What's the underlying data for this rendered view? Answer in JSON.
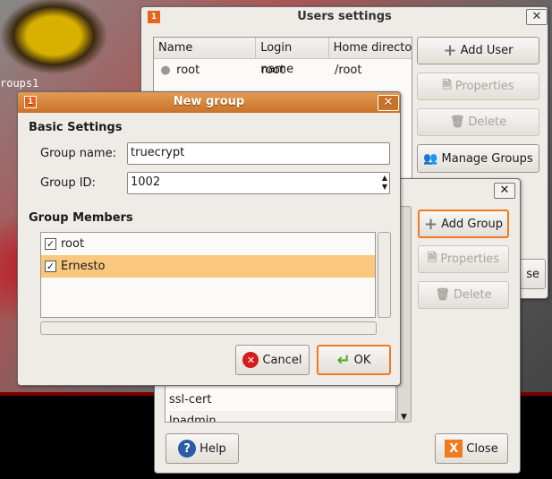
{
  "desktop": {
    "label": "roups1"
  },
  "users_window": {
    "title": "Users settings",
    "columns": [
      "Name",
      "Login name",
      "Home directo"
    ],
    "rows": [
      {
        "name": "root",
        "login": "root",
        "home": "/root"
      }
    ],
    "buttons": {
      "add_user": "Add User",
      "properties": "Properties",
      "delete": "Delete",
      "manage_groups": "Manage Groups",
      "close_partial": "se"
    }
  },
  "groups_window": {
    "rows": [
      "ssl-cert",
      "lpadmin"
    ],
    "buttons": {
      "add_group": "Add Group",
      "properties": "Properties",
      "delete": "Delete",
      "help": "Help",
      "close": "Close"
    }
  },
  "new_group": {
    "title": "New group",
    "basic_settings": "Basic Settings",
    "group_name_label": "Group name:",
    "group_name_value": "truecrypt",
    "group_id_label": "Group ID:",
    "group_id_value": "1002",
    "group_members": "Group Members",
    "members": [
      {
        "name": "root",
        "checked": true
      },
      {
        "name": "Ernesto",
        "checked": true,
        "selected": true
      }
    ],
    "cancel": "Cancel",
    "ok": "OK"
  },
  "colors": {
    "accent": "#f07a1e",
    "selection": "#f9c77e",
    "titlebar": "#d9843a"
  }
}
